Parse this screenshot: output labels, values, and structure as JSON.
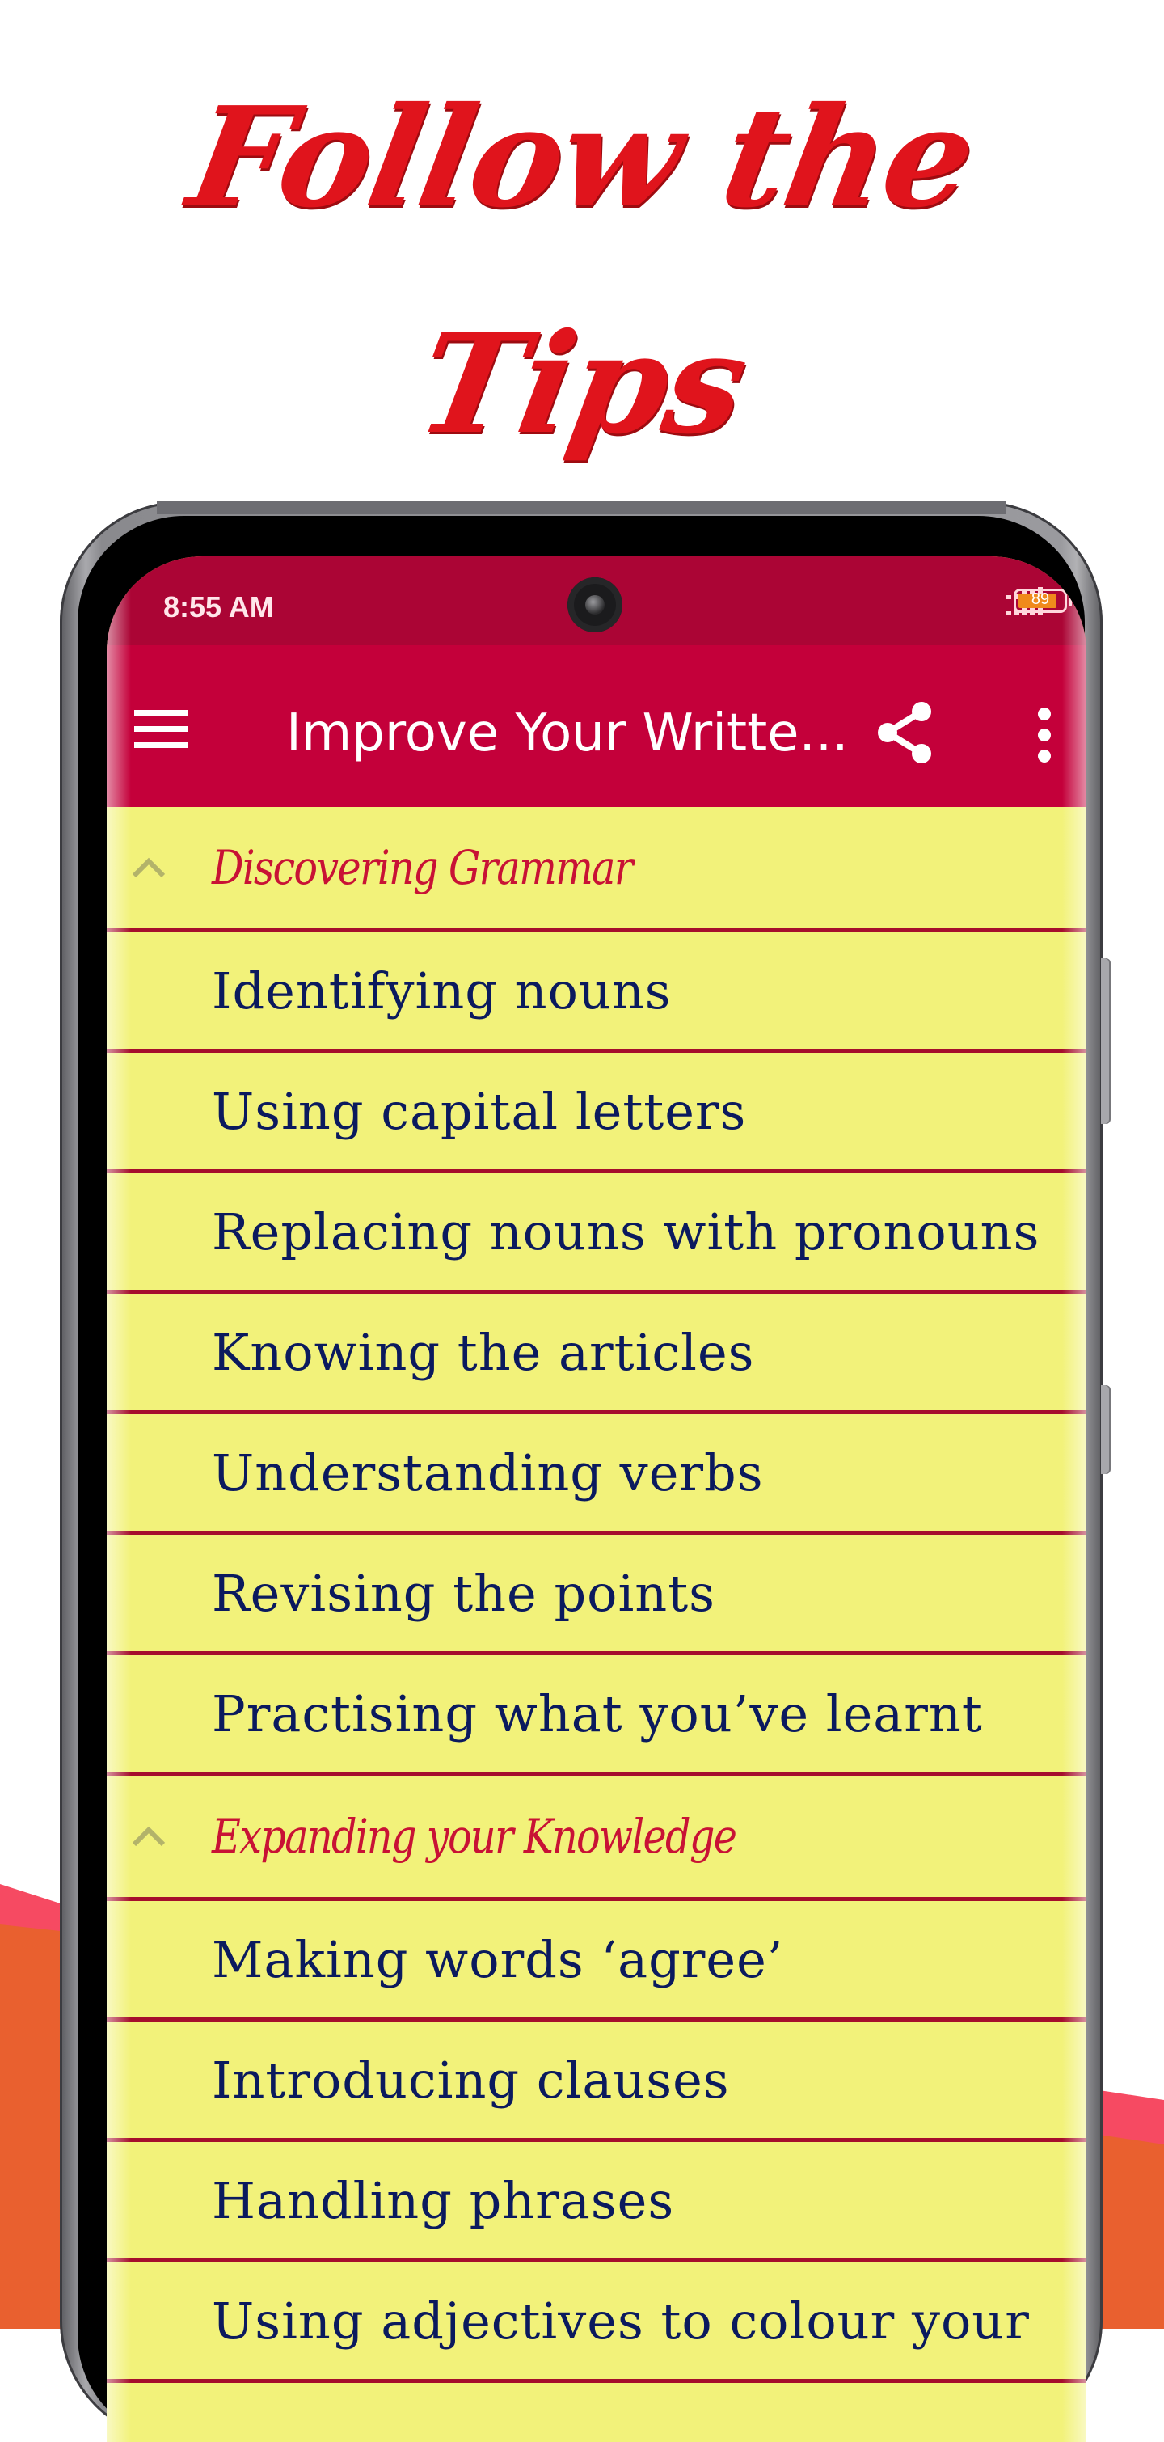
{
  "promo": {
    "headline_line1": "Follow the",
    "headline_line2": "Tips"
  },
  "colors": {
    "headline": "#e0141c",
    "status_bar": "#ab0535",
    "app_bar": "#c4003a",
    "list_background": "#f2f27a",
    "separator": "#a50e2c",
    "section_text": "#c81235",
    "item_text": "#0b1a5e",
    "bg_pink": "#f64a62",
    "bg_orange": "#e9602f"
  },
  "status_bar": {
    "time": "8:55 AM",
    "battery_level": "89",
    "battery_percent": 89,
    "signal_icon": "signal-icon",
    "battery_icon": "battery-icon"
  },
  "app_bar": {
    "title": "Improve Your Writte...",
    "menu_icon": "hamburger-menu-icon",
    "share_icon": "share-icon",
    "more_icon": "more-vertical-icon"
  },
  "sections": [
    {
      "title": "Discovering Grammar",
      "expanded": true,
      "items": [
        "Identifying nouns",
        "Using capital letters",
        "Replacing nouns with pronouns",
        "Knowing the articles",
        "Understanding verbs",
        "Revising the points",
        "Practising what you’ve learnt"
      ]
    },
    {
      "title": "Expanding your Knowledge",
      "expanded": true,
      "items": [
        "Making words ‘agree’",
        "Introducing clauses",
        "Handling phrases",
        "Using adjectives to colour your"
      ]
    }
  ]
}
